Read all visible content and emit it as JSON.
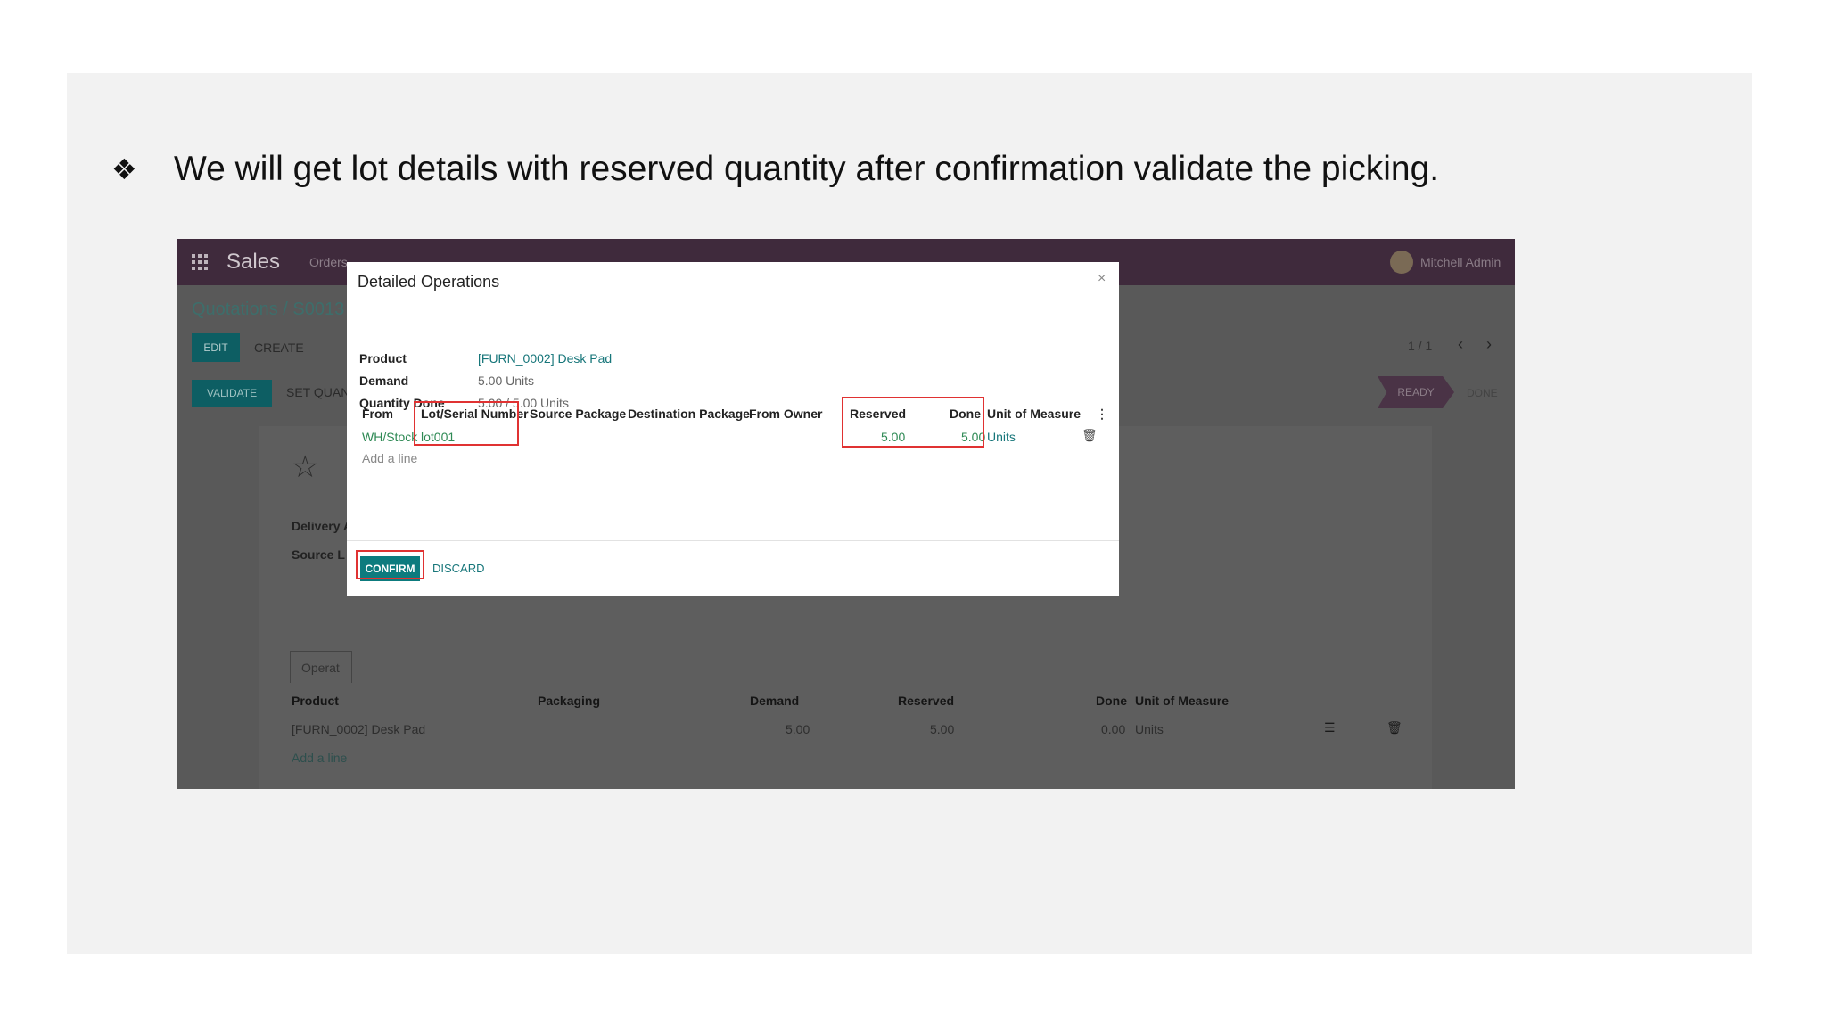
{
  "slide": {
    "bullet_icon": "❖",
    "bullet_text": "We will get lot details with reserved quantity after confirmation validate the picking."
  },
  "app": {
    "name": "Sales",
    "menu_partial": "Orders",
    "user_name": "Mitchell Admin",
    "breadcrumb": "Quotations / S0013",
    "edit_label": "EDIT",
    "create_label": "CREATE",
    "pager": "1 / 1",
    "validate_label": "VALIDATE",
    "set_qty_label": "SET QUAN",
    "status_ready": "READY",
    "status_done": "DONE"
  },
  "background_form": {
    "delivery_label": "Delivery A",
    "source_label": "Source L",
    "tab_label": "Operat",
    "columns": [
      "Product",
      "Packaging",
      "Demand",
      "Reserved",
      "Done",
      "Unit of Measure"
    ],
    "row": {
      "product": "[FURN_0002] Desk Pad",
      "demand": "5.00",
      "reserved": "5.00",
      "done": "0.00",
      "uom": "Units"
    },
    "add_line": "Add a line"
  },
  "modal": {
    "title": "Detailed Operations",
    "close_icon": "×",
    "product_label": "Product",
    "product_value": "[FURN_0002] Desk Pad",
    "demand_label": "Demand",
    "demand_value": "5.00 Units",
    "qty_done_label": "Quantity Done",
    "qty_done_value": "5.00 / 5.00 Units",
    "columns": {
      "from": "From",
      "lot": "Lot/Serial Number",
      "source_package": "Source Package",
      "dest_package": "Destination Package",
      "from_owner": "From Owner",
      "reserved": "Reserved",
      "done": "Done",
      "uom": "Unit of Measure"
    },
    "row": {
      "from": "WH/Stock",
      "lot": "lot001",
      "reserved": "5.00",
      "done": "5.00",
      "uom": "Units"
    },
    "add_line": "Add a line",
    "confirm_label": "CONFIRM",
    "discard_label": "DISCARD"
  },
  "highlight_color": "#e03232",
  "accent_color": "#0d7b7e"
}
